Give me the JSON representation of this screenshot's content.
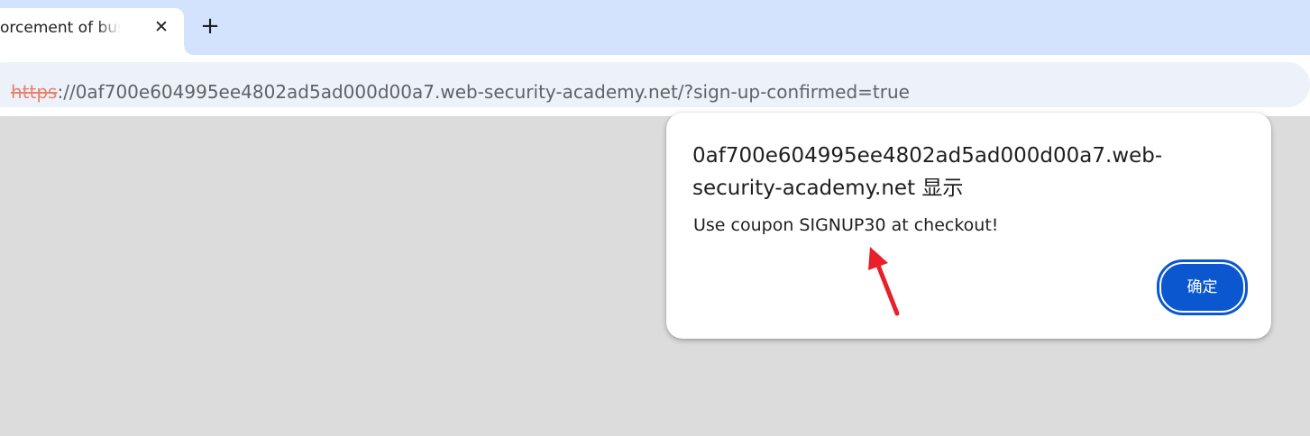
{
  "browser": {
    "tab": {
      "title": "orcement of busin",
      "close_icon": "close-icon"
    },
    "new_tab_icon": "plus-icon",
    "address_bar": {
      "site_icon": "not-secure-icon",
      "scheme": "https",
      "rest": "://0af700e604995ee4802ad5ad000d00a7.web-security-academy.net/?sign-up-confirmed=true"
    }
  },
  "dialog": {
    "title": "0af700e604995ee4802ad5ad000d00a7.web-security-academy.net 显示",
    "message": "Use coupon SIGNUP30 at checkout!",
    "ok_label": "确定"
  },
  "annotation": {
    "arrow_color": "#e8202a"
  },
  "colors": {
    "tabstrip": "#d3e3fd",
    "omnibox": "#edf2fa",
    "page_background": "#dcdcdc",
    "button_primary": "#0b57d0"
  }
}
